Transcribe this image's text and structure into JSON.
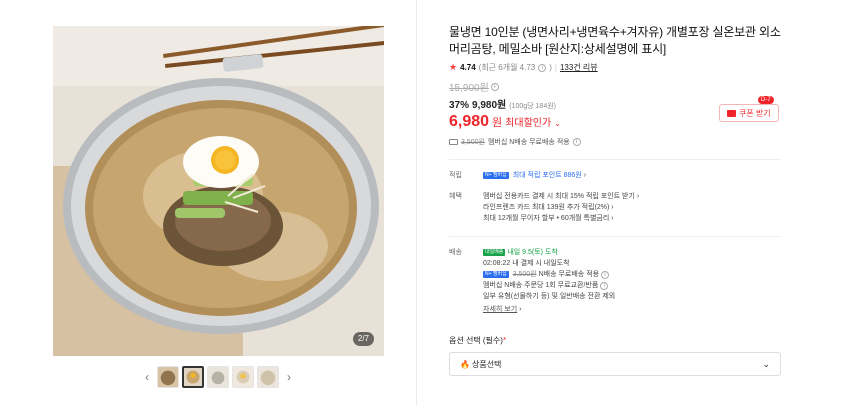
{
  "product": {
    "title": "물냉면 10인분 (냉면사리+냉면육수+겨자유) 개별포장 실온보관 외소머리곰탕, 메밀소바 [원산지:상세설명에 표시]",
    "rating": "4.74",
    "rating_note": "(최근 6개월 4.73",
    "review_link": "133건 리뷰",
    "original_price": "15,900원",
    "discount_rate": "37%",
    "discount_price": "9,980원",
    "unit_price": "(100g당 184원)",
    "max_price": "6,980",
    "max_price_unit": "원",
    "max_label": "최대할인가",
    "coupon": {
      "label": "쿠폰 받기",
      "badge": "D-7"
    },
    "shipping_fee": "3,500원",
    "shipping_note": "멤버십 N배송 무료배송 적용"
  },
  "image": {
    "counter": "2/7",
    "thumb_count": 5,
    "active_thumb": 1
  },
  "points": {
    "label": "적립",
    "npay_tag": "N+ 멤버십",
    "text": "최대 적립 포인트 886원"
  },
  "benefits": {
    "label": "혜택",
    "lines": [
      "멤버십 전용카드 결제 시 최대 15% 적립 포인트 받기",
      "라인프렌즈 카드 최대 139원 추가 적립(2%)",
      "최대 12개월 무이자 할부 • 60개월 특별금리"
    ]
  },
  "delivery": {
    "label": "배송",
    "badge": "내일배송",
    "arrival": "내일 9.5(토) 도착",
    "cutoff": "02:08:22  내 결제 시 내일도착",
    "npay_tag": "N+ 멤버십",
    "fee_strike": "3,500원",
    "fee_note": "N배송 무료배송 적용",
    "exchange": "멤버십 N배송 주문당 1회 무료교환/반품",
    "exclusion": "일부 유형(선물하기 등) 및 일반배송 전환 제외",
    "more_link": "자세히 보기"
  },
  "option": {
    "label": "옵션 선택 (필수)",
    "required_mark": "*",
    "placeholder": "상품선택"
  },
  "colors": {
    "accent": "#f0252b",
    "blue": "#2b6ef0",
    "green": "#18a34a"
  }
}
